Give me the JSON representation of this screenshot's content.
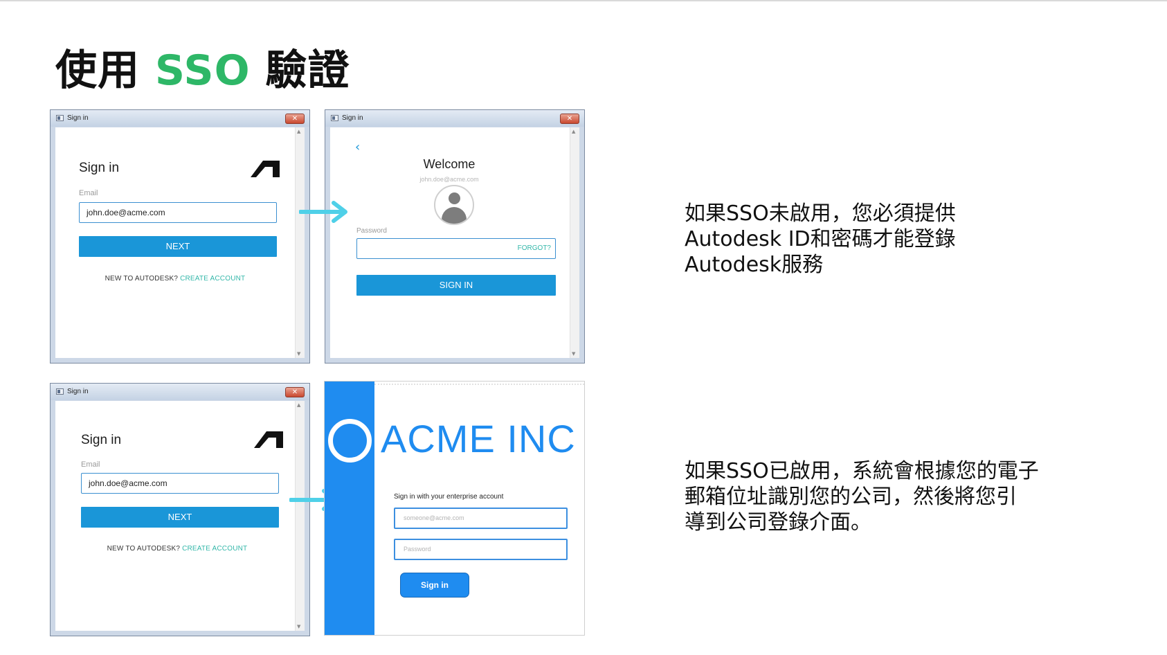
{
  "slide": {
    "title_prefix": "使用 ",
    "title_accent": "SSO",
    "title_suffix": " 驗證",
    "accent_color": "#2eb767"
  },
  "windows": {
    "title": "Sign in",
    "close_glyph": "✕"
  },
  "signin": {
    "heading": "Sign in",
    "email_label": "Email",
    "email_value": "john.doe@acme.com",
    "next_label": "NEXT",
    "new_text": "NEW TO AUTODESK? ",
    "create_link": "CREATE ACCOUNT"
  },
  "welcome": {
    "back_glyph": "‹",
    "heading": "Welcome",
    "email": "john.doe@acme.com",
    "password_label": "Password",
    "forgot_link": "FORGOT?",
    "signin_label": "SIGN IN"
  },
  "acme": {
    "brand": "ACME INC",
    "enterprise_label": "Sign in with your enterprise account",
    "email_placeholder": "someone@acme.com",
    "password_placeholder": "Password",
    "signin_label": "Sign in",
    "brand_color": "#1f8cf0"
  },
  "descriptions": {
    "sso_off": [
      "如果SSO未啟用，您必須提供",
      "Autodesk ID和密碼才能登錄",
      "Autodesk服務"
    ],
    "sso_on": [
      "如果SSO已啟用，系統會根據您的電子",
      "郵箱位址識別您的公司，然後將您引",
      "導到公司登錄介面。"
    ]
  }
}
